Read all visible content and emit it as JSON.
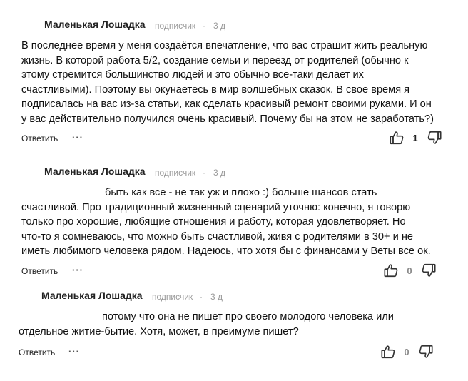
{
  "comments": [
    {
      "author": "Маленькая Лошадка",
      "role": "подписчик",
      "separator": "·",
      "age": "3 д",
      "text": "В последнее время у меня создаётся впечатление, что вас страшит жить реальную\nжизнь. В которой работа 5/2, создание семьи и переезд от родителей (обычно к\nэтому стремится большинство людей и это обычно все-таки делает их\nсчастливыми). Поэтому вы окунаетесь в мир волшебных сказок. В свое время я\nподписалась на вас из-за статьи, как сделать красивый ремонт своими руками. И он\nу вас действительно получился очень красивый. Почему бы на этом не заработать?)",
      "reply_label": "Ответить",
      "more_label": "···",
      "likes": "1"
    },
    {
      "author": "Маленькая Лошадка",
      "role": "подписчик",
      "separator": "·",
      "age": "3 д",
      "text": "быть как все - не так уж и плохо :) больше шансов стать\nсчастливой. Про традиционный жизненный сценарий уточню: конечно, я говорю\nтолько про хорошие, любящие отношения и работу, которая удовлетворяет. Но\nчто-то я сомневаюсь, что можно быть счастливой, живя с родителями в 30+ и не\nиметь любимого человека рядом. Надеюсь, что хотя бы с финансами у Веты все ок.",
      "reply_label": "Ответить",
      "more_label": "···",
      "likes": "0"
    },
    {
      "author": "Маленькая Лошадка",
      "role": "подписчик",
      "separator": "·",
      "age": "3 д",
      "text": "потому что она не пишет про своего молодого человека или\nотдельное житие-бытие. Хотя, может, в преимуме пишет?",
      "reply_label": "Ответить",
      "more_label": "···",
      "likes": "0"
    }
  ],
  "icons": {
    "like": "thumbs-up-icon",
    "dislike": "thumbs-down-icon"
  },
  "colors": {
    "text": "#111111",
    "meta": "#9a9a9a",
    "icon": "#333333"
  }
}
